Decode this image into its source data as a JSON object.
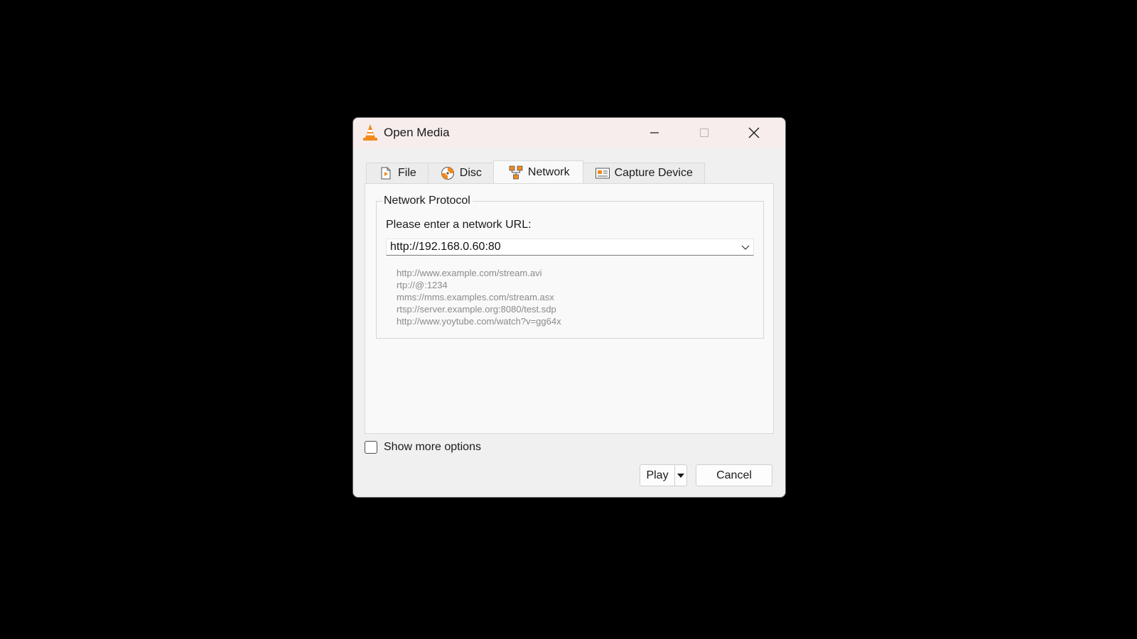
{
  "window": {
    "title": "Open Media",
    "icon": "vlc-cone-icon"
  },
  "tabs": [
    {
      "label": "File",
      "icon": "file-icon",
      "active": false
    },
    {
      "label": "Disc",
      "icon": "disc-icon",
      "active": false
    },
    {
      "label": "Network",
      "icon": "network-icon",
      "active": true
    },
    {
      "label": "Capture Device",
      "icon": "capture-device-icon",
      "active": false
    }
  ],
  "network": {
    "group_title": "Network Protocol",
    "url_label": "Please enter a network URL:",
    "url_value": "http://192.168.0.60:80",
    "examples": [
      "http://www.example.com/stream.avi",
      "rtp://@:1234",
      "mms://mms.examples.com/stream.asx",
      "rtsp://server.example.org:8080/test.sdp",
      "http://www.yoytube.com/watch?v=gg64x"
    ]
  },
  "options": {
    "show_more_label": "Show more options",
    "show_more_checked": false
  },
  "buttons": {
    "play_label": "Play",
    "cancel_label": "Cancel"
  },
  "colors": {
    "vlc_orange": "#f08a1c",
    "titlebar": "#f7eded",
    "hint_text": "#8a8a8a"
  }
}
